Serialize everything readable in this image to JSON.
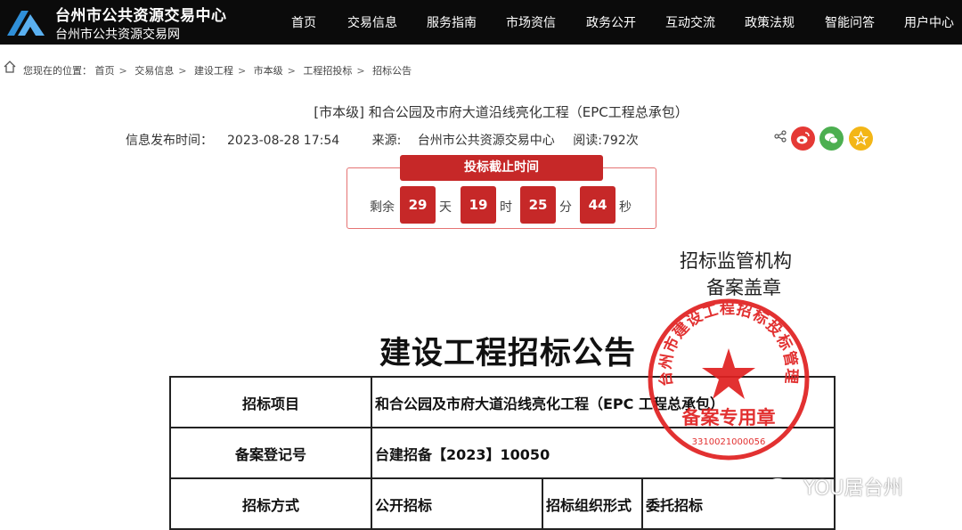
{
  "header": {
    "site_title": "台州市公共资源交易中心",
    "site_subtitle": "台州市公共资源交易网",
    "nav": [
      "首页",
      "交易信息",
      "服务指南",
      "市场资信",
      "政务公开",
      "互动交流",
      "政策法规",
      "智能问答",
      "用户中心"
    ]
  },
  "breadcrumb": {
    "prefix": "您现在的位置：",
    "items": [
      "首页",
      "交易信息",
      "建设工程",
      "市本级",
      "工程招投标",
      "招标公告"
    ]
  },
  "article": {
    "title": "[市本级] 和合公园及市府大道沿线亮化工程（EPC工程总承包）",
    "publish_label": "信息发布时间：",
    "publish_time": "2023-08-28 17:54",
    "source_label": "来源:",
    "source": "台州市公共资源交易中心",
    "reads": "阅读:792次"
  },
  "countdown": {
    "title": "投标截止时间",
    "remaining_label": "剩余",
    "days": "29",
    "day_unit": "天",
    "hours": "19",
    "hour_unit": "时",
    "minutes": "25",
    "minute_unit": "分",
    "seconds": "44",
    "second_unit": "秒"
  },
  "document": {
    "stamp_caption_1": "招标监管机构",
    "stamp_caption_2": "备案盖章",
    "heading": "建设工程招标公告",
    "rows": [
      {
        "label": "招标项目",
        "value": "和合公园及市府大道沿线亮化工程（EPC 工程总承包）"
      },
      {
        "label": "备案登记号",
        "value": "台建招备【2023】10050"
      },
      {
        "label": "招标方式",
        "value": "公开招标",
        "label2": "招标组织形式",
        "value2": "委托招标"
      }
    ],
    "seal_text": "台州市建设工程招标投标管理中心",
    "seal_bottom": "备案专用章",
    "seal_number": "3310021000056"
  },
  "watermark": "YOU居台州",
  "colors": {
    "header_bg": "#0b0b0b",
    "accent_red": "#c62828",
    "weibo": "#e53935",
    "wechat": "#4caf50",
    "favorite": "#f3b617"
  }
}
